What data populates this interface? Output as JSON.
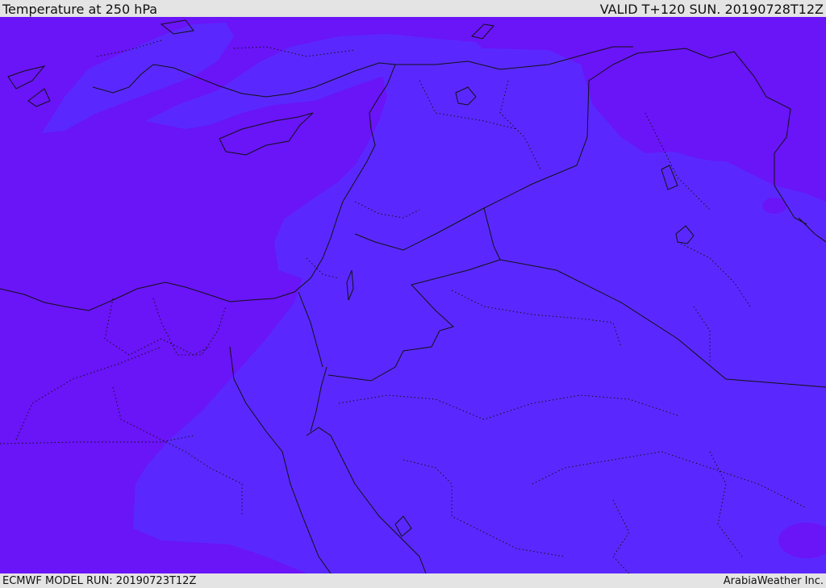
{
  "header": {
    "title": "Temperature at 250 hPa",
    "valid_time": "VALID T+120 SUN. 20190728T12Z"
  },
  "footer": {
    "model_run": "ECMWF MODEL RUN: 20190723T12Z",
    "credit": "ArabiaWeather Inc."
  },
  "map": {
    "field": "temperature",
    "level": "250 hPa",
    "colors": {
      "colder_shade": "#6a14f8",
      "warmer_shade": "#5a28ff",
      "coast_and_border": "#111111"
    }
  }
}
